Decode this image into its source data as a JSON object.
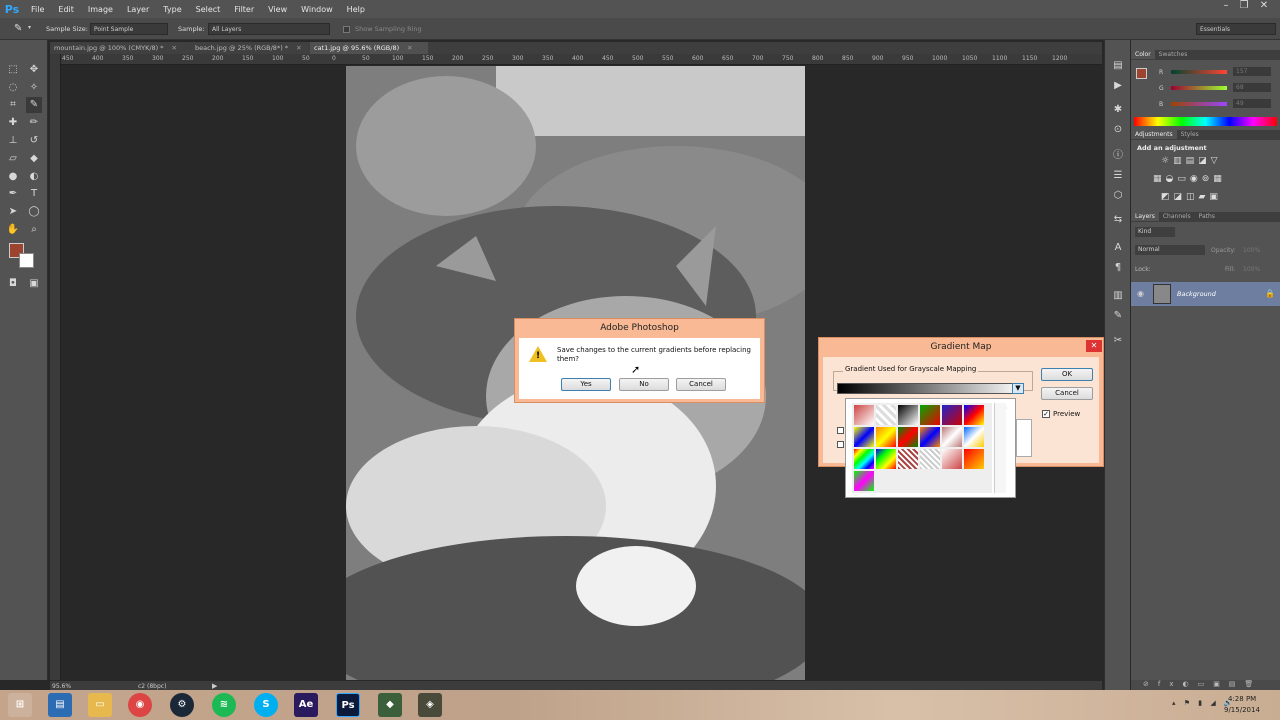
{
  "menu": [
    "File",
    "Edit",
    "Image",
    "Layer",
    "Type",
    "Select",
    "Filter",
    "View",
    "Window",
    "Help"
  ],
  "options_bar": {
    "sample_size_label": "Sample Size:",
    "sample_size_value": "Point Sample",
    "sample_label": "Sample:",
    "sample_value": "All Layers",
    "show_ring": "Show Sampling Ring",
    "workspace": "Essentials"
  },
  "tabs": [
    {
      "label": "mountain.jpg @ 100% (CMYK/8) *"
    },
    {
      "label": "beach.jpg @ 25% (RGB/8*) *"
    },
    {
      "label": "cat1.jpg @ 95.6% (RGB/8)"
    }
  ],
  "ruler_marks": [
    "450",
    "400",
    "350",
    "300",
    "250",
    "200",
    "150",
    "100",
    "50",
    "0",
    "50",
    "100",
    "150",
    "200",
    "250",
    "300",
    "350",
    "400",
    "450",
    "500",
    "550",
    "600",
    "650",
    "700",
    "750",
    "800",
    "850",
    "900",
    "950",
    "1000",
    "1050",
    "1100",
    "1150",
    "1200"
  ],
  "status": {
    "zoom": "95.6%",
    "doc": "c2 (8bpc)"
  },
  "color_panel": {
    "tabs": [
      "Color",
      "Swatches"
    ],
    "r_label": "R",
    "g_label": "G",
    "b_label": "B",
    "r": "157",
    "g": "68",
    "b": "49"
  },
  "adjustments": {
    "tabs": [
      "Adjustments",
      "Styles"
    ],
    "title": "Add an adjustment"
  },
  "layers": {
    "tabs": [
      "Layers",
      "Channels",
      "Paths"
    ],
    "kind": "Kind",
    "blend": "Normal",
    "opacity_label": "Opacity:",
    "opacity": "100%",
    "lock_label": "Lock:",
    "fill_label": "Fill:",
    "fill": "100%",
    "layer_name": "Background"
  },
  "save_dialog": {
    "title": "Adobe Photoshop",
    "message": "Save changes to the current gradients before replacing them?",
    "yes": "Yes",
    "no": "No",
    "cancel": "Cancel"
  },
  "gradient_map": {
    "title": "Gradient Map",
    "group_label": "Gradient Used for Grayscale Mapping",
    "ok": "OK",
    "cancel": "Cancel",
    "preview": "Preview"
  },
  "clock": {
    "time": "4:28 PM",
    "date": "9/15/2014"
  },
  "colors": {
    "fg": "#9d4431",
    "bg": "#ffffff",
    "dialog": "#f8b994",
    "ps_blue": "#31a8ff"
  }
}
